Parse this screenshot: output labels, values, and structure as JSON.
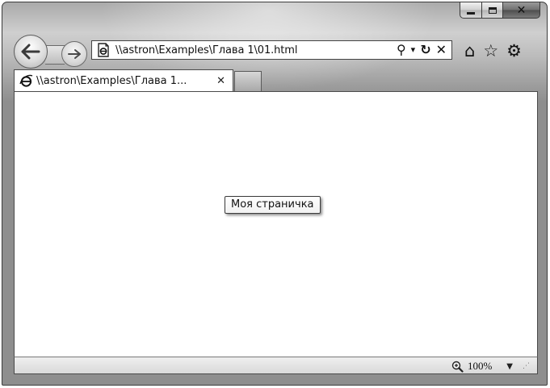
{
  "window": {
    "caption_buttons": {
      "minimize_icon": "minimize-icon",
      "maximize_icon": "maximize-icon",
      "close_glyph": "✕"
    }
  },
  "navigation": {
    "back_icon": "back-arrow-icon",
    "forward_icon": "forward-arrow-icon"
  },
  "address_bar": {
    "url": "\\\\astron\\Examples\\Глава 1\\01.html",
    "page_icon": "ie-page-icon",
    "search_glyph": "⚲",
    "dropdown_glyph": "▾",
    "refresh_glyph": "↻",
    "stop_glyph": "✕"
  },
  "toolbar": {
    "home_glyph": "⌂",
    "favorites_glyph": "☆",
    "tools_glyph": "⚙"
  },
  "tabs": [
    {
      "label": "\\\\astron\\Examples\\Глава 1...",
      "close_glyph": "✕",
      "icon": "ie-logo-icon"
    }
  ],
  "content": {
    "tooltip": "Моя страничка"
  },
  "status_bar": {
    "zoom": "100%",
    "zoom_caret": "▼",
    "grip": "⋰"
  },
  "colors": {
    "frame": "#9c9c9c",
    "content_background": "#ffffff"
  }
}
